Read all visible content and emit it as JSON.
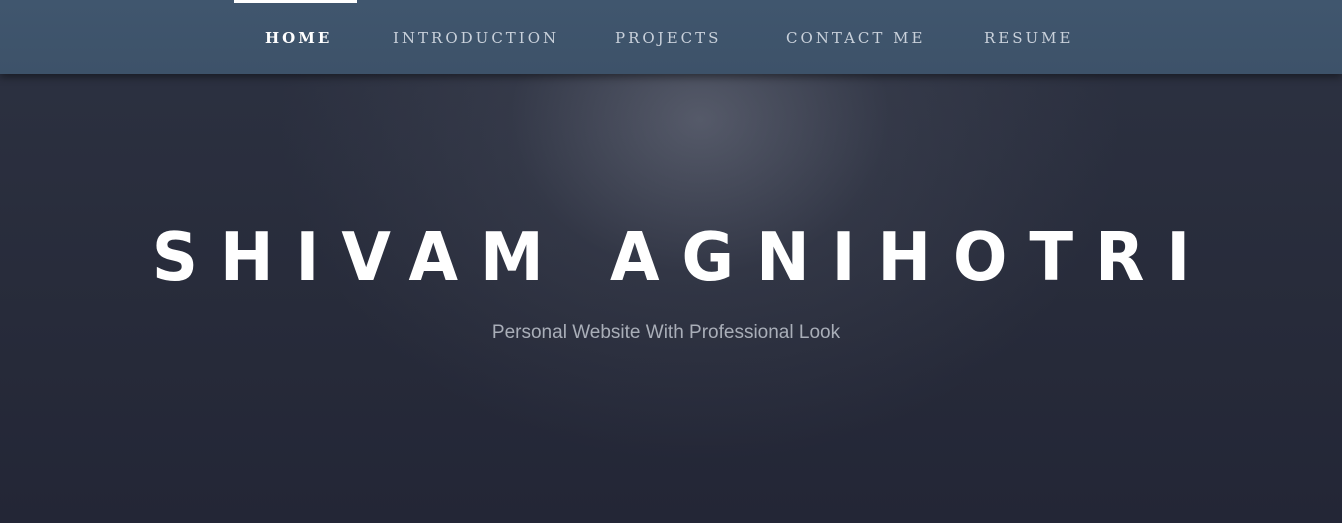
{
  "nav": {
    "items": [
      {
        "label": "HOME",
        "active": true
      },
      {
        "label": "INTRODUCTION",
        "active": false
      },
      {
        "label": "PROJECTS",
        "active": false
      },
      {
        "label": "CONTACT ME",
        "active": false
      },
      {
        "label": "RESUME",
        "active": false
      }
    ]
  },
  "hero": {
    "title": "SHIVAM AGNIHOTRI",
    "subtitle": "Personal Website With Professional Look"
  },
  "colors": {
    "navbar": "#3f546b",
    "background": "#272b3a",
    "title": "#ffffff",
    "subtitle": "#a9aeb8",
    "nav_text": "#c9d1db"
  }
}
